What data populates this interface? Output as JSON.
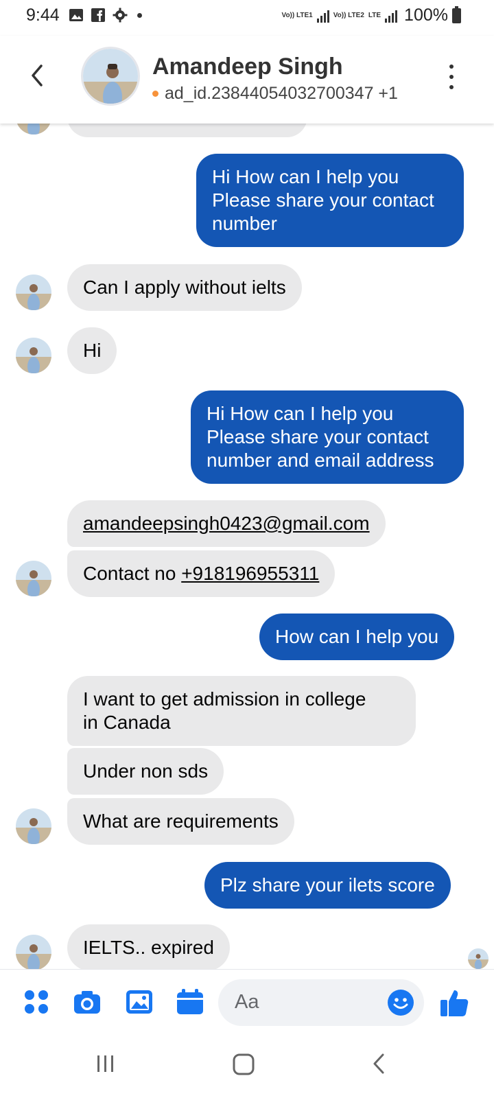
{
  "status_bar": {
    "time": "9:44",
    "net1": "Vo)) LTE1",
    "net2": "Vo)) LTE2",
    "net2_extra": "LTE",
    "battery": "100%"
  },
  "header": {
    "contact_name": "Amandeep Singh",
    "subtitle": "ad_id.23844054032700347 +1"
  },
  "messages": {
    "m1_out": [
      "Hi How can I help you",
      "Please share your contact",
      "number"
    ],
    "m2_in": "Can I apply without ielts",
    "m3_in": "Hi",
    "m4_out": [
      "Hi How can I help you",
      "Please share your contact",
      "number and email address"
    ],
    "m5_in_email": "amandeepsingh0423@gmail.com",
    "m6_in_prefix": "Contact no ",
    "m6_in_phone": "+918196955311",
    "m7_out": "How can I help you",
    "m8_in": [
      "I want to get admission in college",
      "in Canada"
    ],
    "m9_in": "Under non sds",
    "m10_in": "What are requirements",
    "m11_out": "Plz share your ilets score",
    "m12_in": "IELTS.. expired"
  },
  "composer": {
    "placeholder": "Aa",
    "icons": [
      "menu-grid-icon",
      "camera-icon",
      "gallery-icon",
      "calendar-icon",
      "emoji-icon",
      "thumbs-up-icon"
    ]
  },
  "colors": {
    "outgoing_bubble": "#1456b4",
    "incoming_bubble": "#e9e9ea",
    "accent": "#1877f2",
    "status_dot": "#f7923a"
  }
}
